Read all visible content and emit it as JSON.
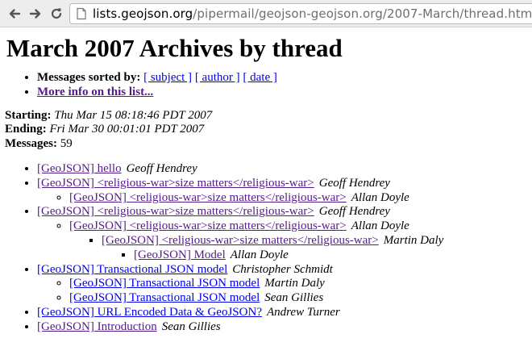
{
  "browser": {
    "url_host": "lists.geojson.org",
    "url_path": "/pipermail/geojson-geojson.org/2007-March/thread.html",
    "icons": {
      "back": "back-arrow-icon",
      "forward": "forward-arrow-icon",
      "reload": "reload-icon",
      "page": "page-icon"
    }
  },
  "page": {
    "title": "March 2007 Archives by thread",
    "sorted_label": "Messages sorted by:",
    "sort_links": [
      "[ subject ]",
      "[ author ]",
      "[ date ]"
    ],
    "more_info": "More info on this list...",
    "starting_label": "Starting:",
    "starting_value": "Thu Mar 15 08:18:46 PDT 2007",
    "ending_label": "Ending:",
    "ending_value": "Fri Mar 30 00:01:01 PDT 2007",
    "messages_label": "Messages:",
    "messages_value": "59"
  },
  "threads": [
    {
      "subject": "[GeoJSON] hello",
      "author": "Geoff Hendrey",
      "visited": true
    },
    {
      "subject": "[GeoJSON] <religious-war>size matters</religious-war>",
      "author": "Geoff Hendrey",
      "visited": true
    },
    {
      "subject": "[GeoJSON] <religious-war>size matters</religious-war>",
      "author": "Allan Doyle",
      "visited": true
    },
    {
      "subject": "[GeoJSON] <religious-war>size matters</religious-war>",
      "author": "Geoff Hendrey",
      "visited": true
    },
    {
      "subject": "[GeoJSON] <religious-war>size matters</religious-war>",
      "author": "Allan Doyle",
      "visited": true
    },
    {
      "subject": "[GeoJSON] <religious-war>size matters</religious-war>",
      "author": "Martin Daly",
      "visited": true
    },
    {
      "subject": "[GeoJSON] Model",
      "author": "Allan Doyle",
      "visited": true
    },
    {
      "subject": "[GeoJSON] Transactional JSON model",
      "author": "Christopher Schmidt",
      "visited": false
    },
    {
      "subject": "[GeoJSON] Transactional JSON model",
      "author": "Martin Daly",
      "visited": false
    },
    {
      "subject": "[GeoJSON] Transactional JSON model",
      "author": "Sean Gillies",
      "visited": false
    },
    {
      "subject": "[GeoJSON] URL Encoded Data & GeoJSON?",
      "author": "Andrew Turner",
      "visited": false
    },
    {
      "subject": "[GeoJSON] Introduction",
      "author": "Sean Gillies",
      "visited": true
    }
  ]
}
